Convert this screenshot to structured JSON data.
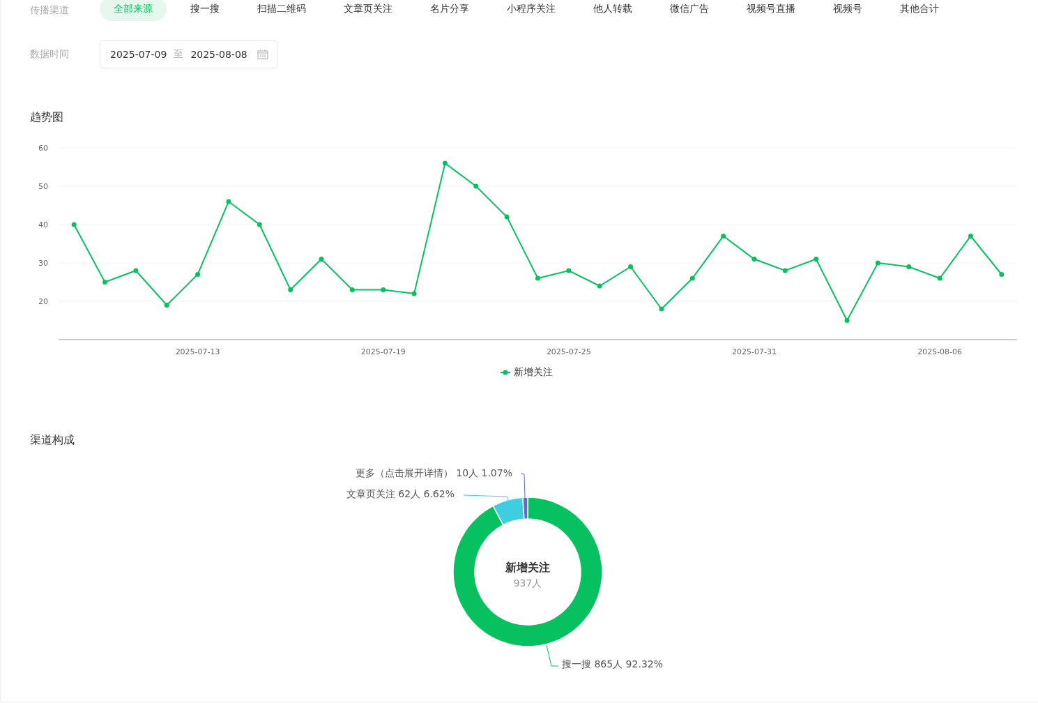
{
  "filters": {
    "label": "传播渠道",
    "channels": [
      {
        "label": "全部来源",
        "selected": true
      },
      {
        "label": "搜一搜",
        "selected": false
      },
      {
        "label": "扫描二维码",
        "selected": false
      },
      {
        "label": "文章页关注",
        "selected": false
      },
      {
        "label": "名片分享",
        "selected": false
      },
      {
        "label": "小程序关注",
        "selected": false
      },
      {
        "label": "他人转载",
        "selected": false
      },
      {
        "label": "微信广告",
        "selected": false
      },
      {
        "label": "视频号直播",
        "selected": false
      },
      {
        "label": "视频号",
        "selected": false
      },
      {
        "label": "其他合计",
        "selected": false
      }
    ]
  },
  "date_range": {
    "label": "数据时间",
    "start": "2025-07-09",
    "separator": "至",
    "end": "2025-08-08"
  },
  "trend": {
    "title": "趋势图",
    "chart_data": {
      "type": "line",
      "categories": [
        null,
        null,
        null,
        null,
        "2025-07-13",
        null,
        null,
        null,
        null,
        null,
        "2025-07-19",
        null,
        null,
        null,
        null,
        null,
        "2025-07-25",
        null,
        null,
        null,
        null,
        null,
        "2025-07-31",
        null,
        null,
        null,
        null,
        null,
        "2025-08-06",
        null,
        null
      ],
      "grid": true,
      "series": [
        {
          "name": "新增关注",
          "color": "#07c160",
          "marker": "circle",
          "values": [
            40,
            25,
            28,
            19,
            27,
            46,
            40,
            23,
            31,
            23,
            23,
            22,
            56,
            50,
            42,
            26,
            28,
            24,
            29,
            18,
            26,
            37,
            31,
            28,
            31,
            15,
            30,
            29,
            26,
            37,
            27
          ]
        }
      ],
      "ylim": [
        10,
        60
      ],
      "yticks": [
        20,
        30,
        40,
        50,
        60
      ]
    }
  },
  "composition": {
    "title": "渠道构成",
    "center_title": "新增关注",
    "center_value": "937人",
    "chart_data": {
      "type": "donut",
      "categories": [
        "搜一搜",
        "文章页关注",
        "更多（点击展开详情）"
      ],
      "values": [
        865,
        62,
        10
      ],
      "colors": [
        "#07c160",
        "#40cde0",
        "#5b6bd0"
      ],
      "value_labels": [
        "865人 92.32%",
        "62人 6.62%",
        "10人 1.07%"
      ]
    }
  }
}
